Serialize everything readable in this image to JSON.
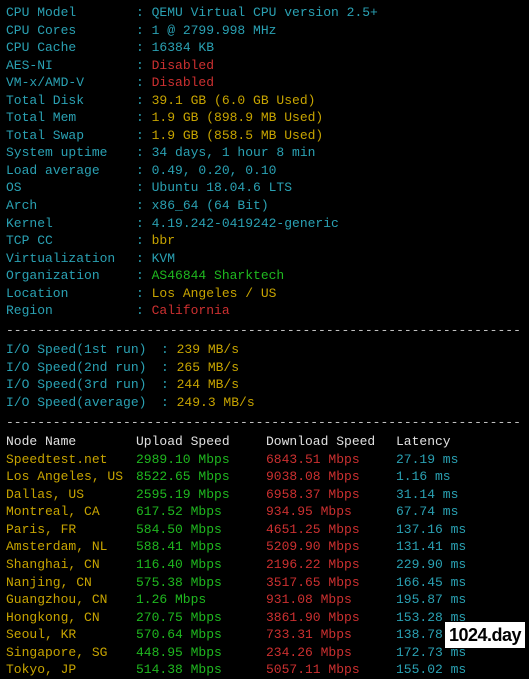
{
  "dash": "----------------------------------------------------------------------",
  "sys": [
    {
      "label": "CPU Model",
      "value": "QEMU Virtual CPU version 2.5+",
      "cls": "val-cy"
    },
    {
      "label": "CPU Cores",
      "value": "1 @ 2799.998 MHz",
      "cls": "val-cy"
    },
    {
      "label": "CPU Cache",
      "value": "16384 KB",
      "cls": "val-cy"
    },
    {
      "label": "AES-NI",
      "value": "Disabled",
      "cls": "val-rd"
    },
    {
      "label": "VM-x/AMD-V",
      "value": "Disabled",
      "cls": "val-rd"
    },
    {
      "label": "Total Disk",
      "value": "39.1 GB (6.0 GB Used)",
      "cls": "val-yl"
    },
    {
      "label": "Total Mem",
      "value": "1.9 GB (898.9 MB Used)",
      "cls": "val-yl"
    },
    {
      "label": "Total Swap",
      "value": "1.9 GB (858.5 MB Used)",
      "cls": "val-yl"
    },
    {
      "label": "System uptime",
      "value": "34 days, 1 hour 8 min",
      "cls": "val-cy"
    },
    {
      "label": "Load average",
      "value": "0.49, 0.20, 0.10",
      "cls": "val-cy"
    },
    {
      "label": "OS",
      "value": "Ubuntu 18.04.6 LTS",
      "cls": "val-cy"
    },
    {
      "label": "Arch",
      "value": "x86_64 (64 Bit)",
      "cls": "val-cy"
    },
    {
      "label": "Kernel",
      "value": "4.19.242-0419242-generic",
      "cls": "val-cy"
    },
    {
      "label": "TCP CC",
      "value": "bbr",
      "cls": "val-yl"
    },
    {
      "label": "Virtualization",
      "value": "KVM",
      "cls": "val-cy"
    },
    {
      "label": "Organization",
      "value": "AS46844 Sharktech",
      "cls": "val-gr"
    },
    {
      "label": "Location",
      "value": "Los Angeles / US",
      "cls": "val-yl"
    },
    {
      "label": "Region",
      "value": "California",
      "cls": "val-rd"
    }
  ],
  "io": [
    {
      "label": "I/O Speed(1st run) ",
      "value": "239 MB/s"
    },
    {
      "label": "I/O Speed(2nd run) ",
      "value": "265 MB/s"
    },
    {
      "label": "I/O Speed(3rd run) ",
      "value": "244 MB/s"
    },
    {
      "label": "I/O Speed(average) ",
      "value": "249.3 MB/s"
    }
  ],
  "speed_hdr": {
    "node": "Node Name",
    "up": "Upload Speed",
    "dn": "Download Speed",
    "lt": "Latency"
  },
  "speed": [
    {
      "node": "Speedtest.net",
      "up": "2989.10 Mbps",
      "dn": "6843.51 Mbps",
      "lt": "27.19 ms"
    },
    {
      "node": "Los Angeles, US",
      "up": "8522.65 Mbps",
      "dn": "9038.08 Mbps",
      "lt": "1.16 ms"
    },
    {
      "node": "Dallas, US",
      "up": "2595.19 Mbps",
      "dn": "6958.37 Mbps",
      "lt": "31.14 ms"
    },
    {
      "node": "Montreal, CA",
      "up": "617.52 Mbps",
      "dn": "934.95 Mbps",
      "lt": "67.74 ms"
    },
    {
      "node": "Paris, FR",
      "up": "584.50 Mbps",
      "dn": "4651.25 Mbps",
      "lt": "137.16 ms"
    },
    {
      "node": "Amsterdam, NL",
      "up": "588.41 Mbps",
      "dn": "5209.90 Mbps",
      "lt": "131.41 ms"
    },
    {
      "node": "Shanghai, CN",
      "up": "116.40 Mbps",
      "dn": "2196.22 Mbps",
      "lt": "229.90 ms"
    },
    {
      "node": "Nanjing, CN",
      "up": "575.38 Mbps",
      "dn": "3517.65 Mbps",
      "lt": "166.45 ms"
    },
    {
      "node": "Guangzhou, CN",
      "up": "1.26 Mbps",
      "dn": "931.08 Mbps",
      "lt": "195.87 ms"
    },
    {
      "node": "Hongkong, CN",
      "up": "270.75 Mbps",
      "dn": "3861.90 Mbps",
      "lt": "153.28 ms"
    },
    {
      "node": "Seoul, KR",
      "up": "570.64 Mbps",
      "dn": "733.31 Mbps",
      "lt": "138.78 ms"
    },
    {
      "node": "Singapore, SG",
      "up": "448.95 Mbps",
      "dn": "234.26 Mbps",
      "lt": "172.73 ms"
    },
    {
      "node": "Tokyo, JP",
      "up": "514.38 Mbps",
      "dn": "5057.11 Mbps",
      "lt": "155.02 ms"
    }
  ],
  "watermark": "1024.day"
}
